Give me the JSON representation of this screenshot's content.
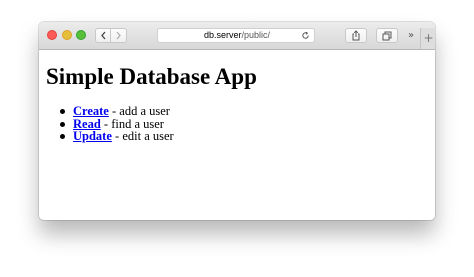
{
  "browser": {
    "url_host": "db.server",
    "url_path": "/public/",
    "overflow_label": "»",
    "new_tab_label": "+",
    "colors": {
      "close": "#fc5b57",
      "minimize": "#e5bf3c",
      "maximize": "#57c038"
    },
    "icons": {
      "back": "chevron-left-icon",
      "forward": "chevron-right-icon",
      "reload": "reload-icon",
      "share": "share-icon",
      "tabs": "tabs-overview-icon"
    }
  },
  "page": {
    "title": "Simple Database App",
    "items": [
      {
        "link": "Create",
        "desc": " - add a user"
      },
      {
        "link": "Read",
        "desc": " - find a user"
      },
      {
        "link": "Update",
        "desc": " - edit a user"
      }
    ],
    "link_color": "#0000ee"
  }
}
